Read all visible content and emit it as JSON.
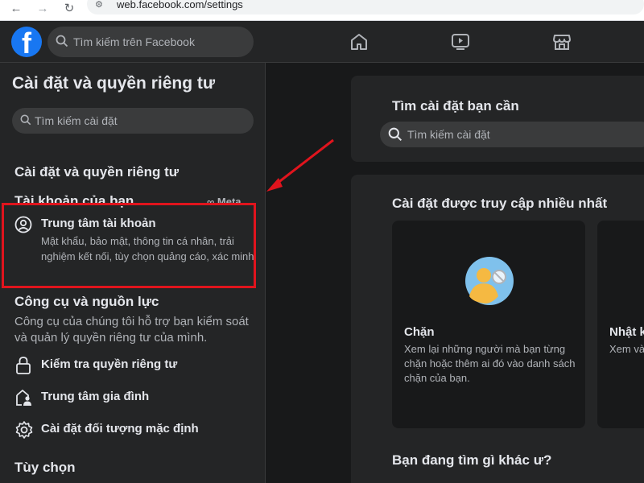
{
  "browser": {
    "url": "web.facebook.com/settings"
  },
  "topbar": {
    "logo_letter": "f",
    "search_placeholder": "Tìm kiếm trên Facebook",
    "nav_icons": [
      "home-icon",
      "video-icon",
      "marketplace-icon"
    ]
  },
  "sidebar": {
    "title": "Cài đặt và quyền riêng tư",
    "search_placeholder": "Tìm kiếm cài đặt",
    "section_privacy": "Cài đặt và quyền riêng tư",
    "account_heading": "Tài khoản của bạn",
    "meta_label": "∞ Meta",
    "account_center": {
      "name": "Trung tâm tài khoản",
      "description": "Mật khẩu, bảo mật, thông tin cá nhân, trải nghiệm kết nối, tùy chọn quảng cáo, xác minh"
    },
    "tools_heading": "Công cụ và nguồn lực",
    "tools_description": "Công cụ của chúng tôi hỗ trợ bạn kiểm soát và quản lý quyền riêng tư của mình.",
    "tools": [
      {
        "label": "Kiểm tra quyền riêng tư",
        "icon": "lock-icon"
      },
      {
        "label": "Trung tâm gia đình",
        "icon": "family-icon"
      },
      {
        "label": "Cài đặt đối tượng mặc định",
        "icon": "gear-icon"
      }
    ],
    "options_heading": "Tùy chọn"
  },
  "main": {
    "find_title": "Tìm cài đặt bạn cần",
    "find_placeholder": "Tìm kiếm cài đặt",
    "most_accessed_title": "Cài đặt được truy cập nhiều nhất",
    "cards": [
      {
        "title": "Chặn",
        "description": "Xem lại những người mà bạn từng chặn hoặc thêm ai đó vào danh sách chặn của bạn."
      },
      {
        "title": "Nhật ký",
        "description": "Xem và quản lý bạn từng..."
      }
    ],
    "other_title": "Bạn đang tìm gì khác ư?"
  },
  "colors": {
    "brand": "#1877f2",
    "annotation": "#e0141d",
    "surface": "#242526",
    "background": "#18191a"
  }
}
